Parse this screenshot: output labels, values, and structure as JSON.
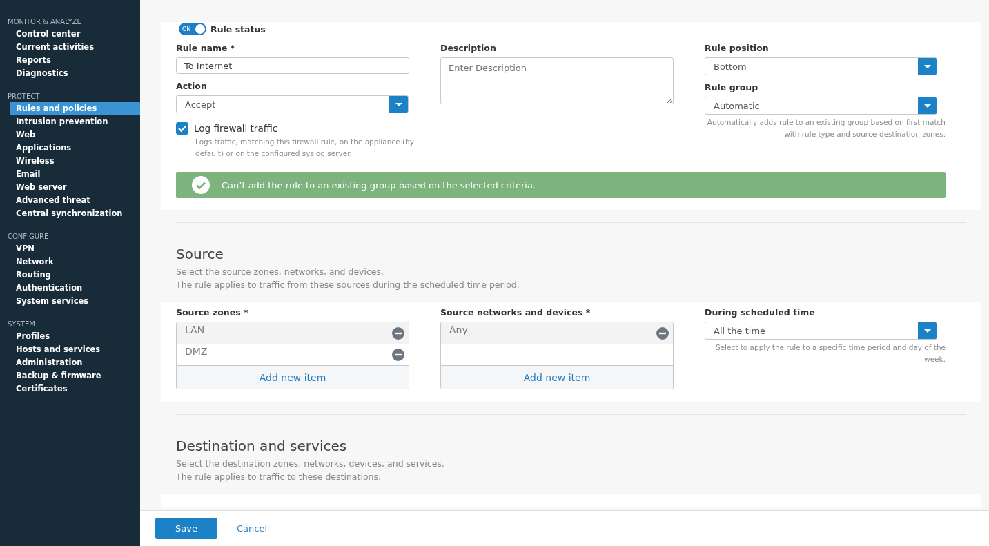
{
  "sidebar": {
    "sections": [
      {
        "heading": "MONITOR & ANALYZE",
        "items": [
          {
            "label": "Control center",
            "selected": false
          },
          {
            "label": "Current activities",
            "selected": false
          },
          {
            "label": "Reports",
            "selected": false
          },
          {
            "label": "Diagnostics",
            "selected": false
          }
        ]
      },
      {
        "heading": "PROTECT",
        "items": [
          {
            "label": "Rules and policies",
            "selected": true
          },
          {
            "label": "Intrusion prevention",
            "selected": false
          },
          {
            "label": "Web",
            "selected": false
          },
          {
            "label": "Applications",
            "selected": false
          },
          {
            "label": "Wireless",
            "selected": false
          },
          {
            "label": "Email",
            "selected": false
          },
          {
            "label": "Web server",
            "selected": false
          },
          {
            "label": "Advanced threat",
            "selected": false
          },
          {
            "label": "Central synchronization",
            "selected": false
          }
        ]
      },
      {
        "heading": "CONFIGURE",
        "items": [
          {
            "label": "VPN",
            "selected": false
          },
          {
            "label": "Network",
            "selected": false
          },
          {
            "label": "Routing",
            "selected": false
          },
          {
            "label": "Authentication",
            "selected": false
          },
          {
            "label": "System services",
            "selected": false
          }
        ]
      },
      {
        "heading": "SYSTEM",
        "items": [
          {
            "label": "Profiles",
            "selected": false
          },
          {
            "label": "Hosts and services",
            "selected": false
          },
          {
            "label": "Administration",
            "selected": false
          },
          {
            "label": "Backup & firmware",
            "selected": false
          },
          {
            "label": "Certificates",
            "selected": false
          }
        ]
      }
    ]
  },
  "rule_status": {
    "toggle_text": "ON",
    "on": true,
    "label": "Rule status"
  },
  "rule_name": {
    "label": "Rule name *",
    "value": "To Internet"
  },
  "action": {
    "label": "Action",
    "value": "Accept"
  },
  "log_traffic": {
    "label": "Log firewall traffic",
    "checked": true,
    "hint": "Logs traffic, matching this firewall rule, on the appliance (by default) or on the configured syslog server."
  },
  "description": {
    "label": "Description",
    "placeholder": "Enter Description"
  },
  "rule_position": {
    "label": "Rule position",
    "value": "Bottom"
  },
  "rule_group": {
    "label": "Rule group",
    "value": "Automatic",
    "hint": "Automatically adds rule to an existing group based on first match with rule type and source-destination zones."
  },
  "banner": {
    "text": "Can’t add the rule to an existing group based on the selected criteria."
  },
  "source": {
    "title": "Source",
    "description": [
      "Select the source zones, networks, and devices.",
      "The rule applies to traffic from these sources during the scheduled time period."
    ],
    "zones": {
      "label": "Source zones *",
      "items": [
        "LAN",
        "DMZ"
      ],
      "add": "Add new item"
    },
    "networks": {
      "label": "Source networks and devices *",
      "items": [
        "Any"
      ],
      "add": "Add new item"
    },
    "schedule": {
      "label": "During scheduled time",
      "value": "All the time",
      "hint": "Select to apply the rule to a specific time period and day of the week."
    }
  },
  "destination": {
    "title": "Destination and services",
    "description": [
      "Select the destination zones, networks, devices, and services.",
      "The rule applies to traffic to these destinations."
    ]
  },
  "footer": {
    "save": "Save",
    "cancel": "Cancel"
  }
}
